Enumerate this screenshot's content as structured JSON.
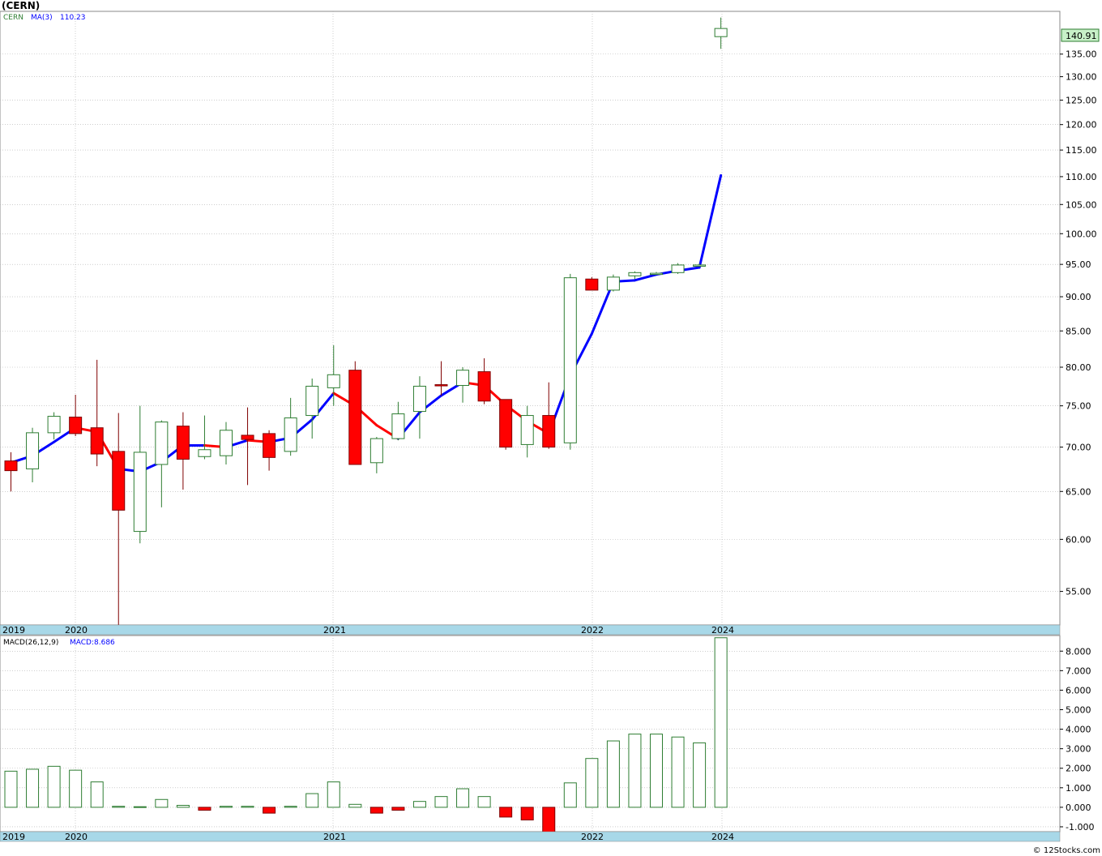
{
  "title": "(CERN)",
  "credit": "© 12Stocks.com",
  "colors": {
    "axis_bar": "#a8d8e8",
    "up_candle": "#2e7d32",
    "down_candle": "#ff0000",
    "ma_up": "#0000ff",
    "ma_down": "#ff0000",
    "macd_pos": "#2e7d32",
    "macd_neg": "#ff0000",
    "last_price_bg": "#c8f0c8",
    "grid": "#b0b0b0"
  },
  "price_panel": {
    "legend": {
      "symbol": "CERN",
      "ma_label": "MA(3)",
      "ma_value": "110.23"
    },
    "last_price": "140.91",
    "y_ticks": [
      "135.00",
      "130.00",
      "125.00",
      "120.00",
      "115.00",
      "110.00",
      "105.00",
      "100.00",
      "95.00",
      "90.00",
      "85.00",
      "80.00",
      "75.00",
      "70.00",
      "65.00",
      "60.00",
      "55.00"
    ]
  },
  "macd_panel": {
    "legend": {
      "label": "MACD(26,12,9)",
      "value_label": "MACD:8.686"
    },
    "y_ticks": [
      "8.000",
      "7.000",
      "6.000",
      "5.000",
      "4.000",
      "3.000",
      "2.000",
      "1.000",
      "0.000",
      "-1.000"
    ]
  },
  "date_axis": [
    "2019",
    "2020",
    "2021",
    "2022",
    "2024"
  ],
  "chart_data": [
    {
      "type": "candlestick",
      "title": "(CERN)",
      "scale": "log",
      "ylim": [
        52,
        145
      ],
      "series_name": "CERN",
      "candles": [
        {
          "o": 68.4,
          "h": 69.4,
          "l": 65.0,
          "c": 67.3
        },
        {
          "o": 67.5,
          "h": 72.3,
          "l": 66.0,
          "c": 71.7
        },
        {
          "o": 71.7,
          "h": 74.2,
          "l": 70.9,
          "c": 73.7
        },
        {
          "o": 73.6,
          "h": 76.4,
          "l": 71.3,
          "c": 71.6
        },
        {
          "o": 72.3,
          "h": 81.0,
          "l": 67.8,
          "c": 69.2
        },
        {
          "o": 69.5,
          "h": 74.1,
          "l": 52.0,
          "c": 63.0
        },
        {
          "o": 60.8,
          "h": 75.0,
          "l": 59.6,
          "c": 69.4
        },
        {
          "o": 68.0,
          "h": 73.2,
          "l": 63.3,
          "c": 73.0
        },
        {
          "o": 72.5,
          "h": 74.2,
          "l": 65.2,
          "c": 68.6
        },
        {
          "o": 68.9,
          "h": 73.8,
          "l": 68.6,
          "c": 69.7
        },
        {
          "o": 69.0,
          "h": 73.0,
          "l": 68.0,
          "c": 72.0
        },
        {
          "o": 71.4,
          "h": 74.8,
          "l": 65.7,
          "c": 70.9
        },
        {
          "o": 71.6,
          "h": 72.0,
          "l": 67.3,
          "c": 68.8
        },
        {
          "o": 69.5,
          "h": 76.0,
          "l": 69.0,
          "c": 73.5
        },
        {
          "o": 73.8,
          "h": 78.5,
          "l": 71.0,
          "c": 77.5
        },
        {
          "o": 77.3,
          "h": 83.0,
          "l": 75.0,
          "c": 79.0
        },
        {
          "o": 79.6,
          "h": 80.8,
          "l": 68.1,
          "c": 68.0
        },
        {
          "o": 68.2,
          "h": 71.2,
          "l": 67.0,
          "c": 71.0
        },
        {
          "o": 71.0,
          "h": 75.5,
          "l": 70.8,
          "c": 74.0
        },
        {
          "o": 74.3,
          "h": 78.8,
          "l": 71.0,
          "c": 77.5
        },
        {
          "o": 77.7,
          "h": 80.8,
          "l": 76.3,
          "c": 77.6
        },
        {
          "o": 77.6,
          "h": 80.0,
          "l": 75.4,
          "c": 79.6
        },
        {
          "o": 79.4,
          "h": 81.2,
          "l": 75.2,
          "c": 75.6
        },
        {
          "o": 75.8,
          "h": 75.8,
          "l": 69.7,
          "c": 70.0
        },
        {
          "o": 70.3,
          "h": 75.0,
          "l": 68.8,
          "c": 73.8
        },
        {
          "o": 73.8,
          "h": 78.0,
          "l": 69.8,
          "c": 70.0
        },
        {
          "o": 70.5,
          "h": 93.5,
          "l": 69.7,
          "c": 92.9
        },
        {
          "o": 92.7,
          "h": 93.0,
          "l": 91.0,
          "c": 91.0
        },
        {
          "o": 91.0,
          "h": 93.4,
          "l": 90.8,
          "c": 93.0
        },
        {
          "o": 93.2,
          "h": 93.9,
          "l": 92.7,
          "c": 93.7
        },
        {
          "o": 93.6,
          "h": 93.8,
          "l": 93.4,
          "c": 93.6
        },
        {
          "o": 93.7,
          "h": 95.2,
          "l": 93.5,
          "c": 94.9
        },
        {
          "o": 94.8,
          "h": 95.1,
          "l": 94.7,
          "c": 94.9
        },
        {
          "o": 139.0,
          "h": 143.5,
          "l": 136.2,
          "c": 140.91
        }
      ],
      "ma3": [
        68.2,
        69.0,
        70.6,
        72.3,
        71.8,
        67.5,
        67.2,
        68.3,
        70.2,
        70.2,
        70.0,
        70.8,
        70.6,
        71.1,
        73.3,
        76.6,
        75.0,
        72.6,
        71.0,
        74.2,
        76.3,
        78.0,
        77.6,
        75.1,
        73.1,
        71.6,
        78.9,
        84.6,
        92.3,
        92.5,
        93.4,
        94.0,
        94.5,
        110.23
      ],
      "ma_color_flags": [
        "up",
        "up",
        "up",
        "up",
        "down",
        "down",
        "up",
        "up",
        "up",
        "up",
        "down",
        "up",
        "down",
        "up",
        "up",
        "up",
        "down",
        "down",
        "down",
        "up",
        "up",
        "up",
        "down",
        "down",
        "down",
        "down",
        "up",
        "up",
        "up",
        "up",
        "up",
        "up",
        "up",
        "up"
      ]
    },
    {
      "type": "bar",
      "title": "MACD(26,12,9)",
      "ylim": [
        -1.25,
        8.8
      ],
      "values": [
        1.85,
        1.95,
        2.1,
        1.9,
        1.3,
        0.05,
        0.03,
        0.4,
        0.1,
        -0.15,
        0.05,
        0.05,
        -0.3,
        0.05,
        0.7,
        1.3,
        0.15,
        -0.3,
        -0.15,
        0.3,
        0.55,
        0.95,
        0.55,
        -0.5,
        -0.65,
        -1.4,
        1.25,
        2.5,
        3.4,
        3.75,
        3.75,
        3.6,
        3.3,
        8.686
      ]
    }
  ]
}
